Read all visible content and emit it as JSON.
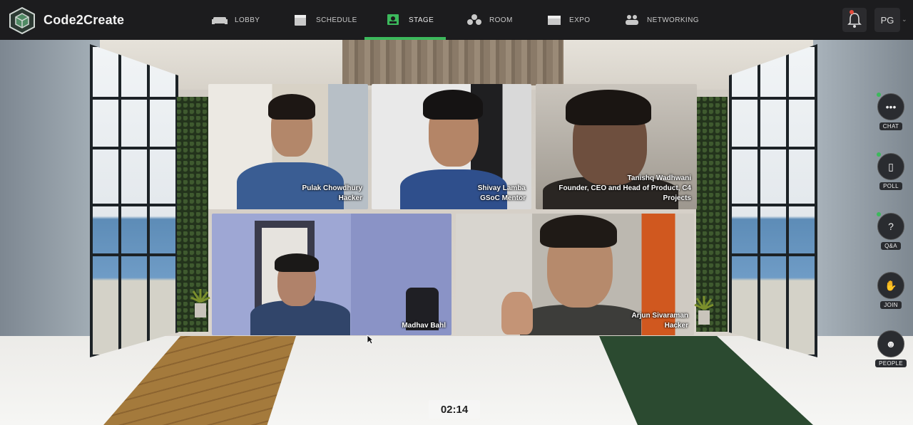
{
  "app": {
    "brand": "Code2Create"
  },
  "nav": {
    "items": [
      {
        "label": "LOBBY",
        "icon": "sofa-icon"
      },
      {
        "label": "SCHEDULE",
        "icon": "calendar-icon"
      },
      {
        "label": "STAGE",
        "icon": "stage-icon",
        "active": true
      },
      {
        "label": "ROOM",
        "icon": "room-icon"
      },
      {
        "label": "EXPO",
        "icon": "expo-icon"
      },
      {
        "label": "NETWORKING",
        "icon": "networking-icon"
      }
    ],
    "accent": "#3cb95c"
  },
  "header": {
    "avatar_initials": "PG",
    "notification_icon": "bell-icon"
  },
  "stage": {
    "timer": "02:14",
    "speakers": [
      {
        "name": "Pulak Chowdhury",
        "role": "Hacker"
      },
      {
        "name": "Shivay Lamba",
        "role": "GSoC Mentor"
      },
      {
        "name": "Tanishq Wadhwani",
        "role_line1": "Founder, CEO and Head of Product, C4",
        "role_line2": "Projects"
      },
      {
        "name": "Madhav Bahl",
        "role": ""
      },
      {
        "name": "Arjun Sivaraman",
        "role": "Hacker"
      }
    ]
  },
  "sidebar": {
    "chat": "CHAT",
    "poll": "POLL",
    "qa": "Q&A",
    "join": "JOIN",
    "people": "PEOPLE"
  }
}
